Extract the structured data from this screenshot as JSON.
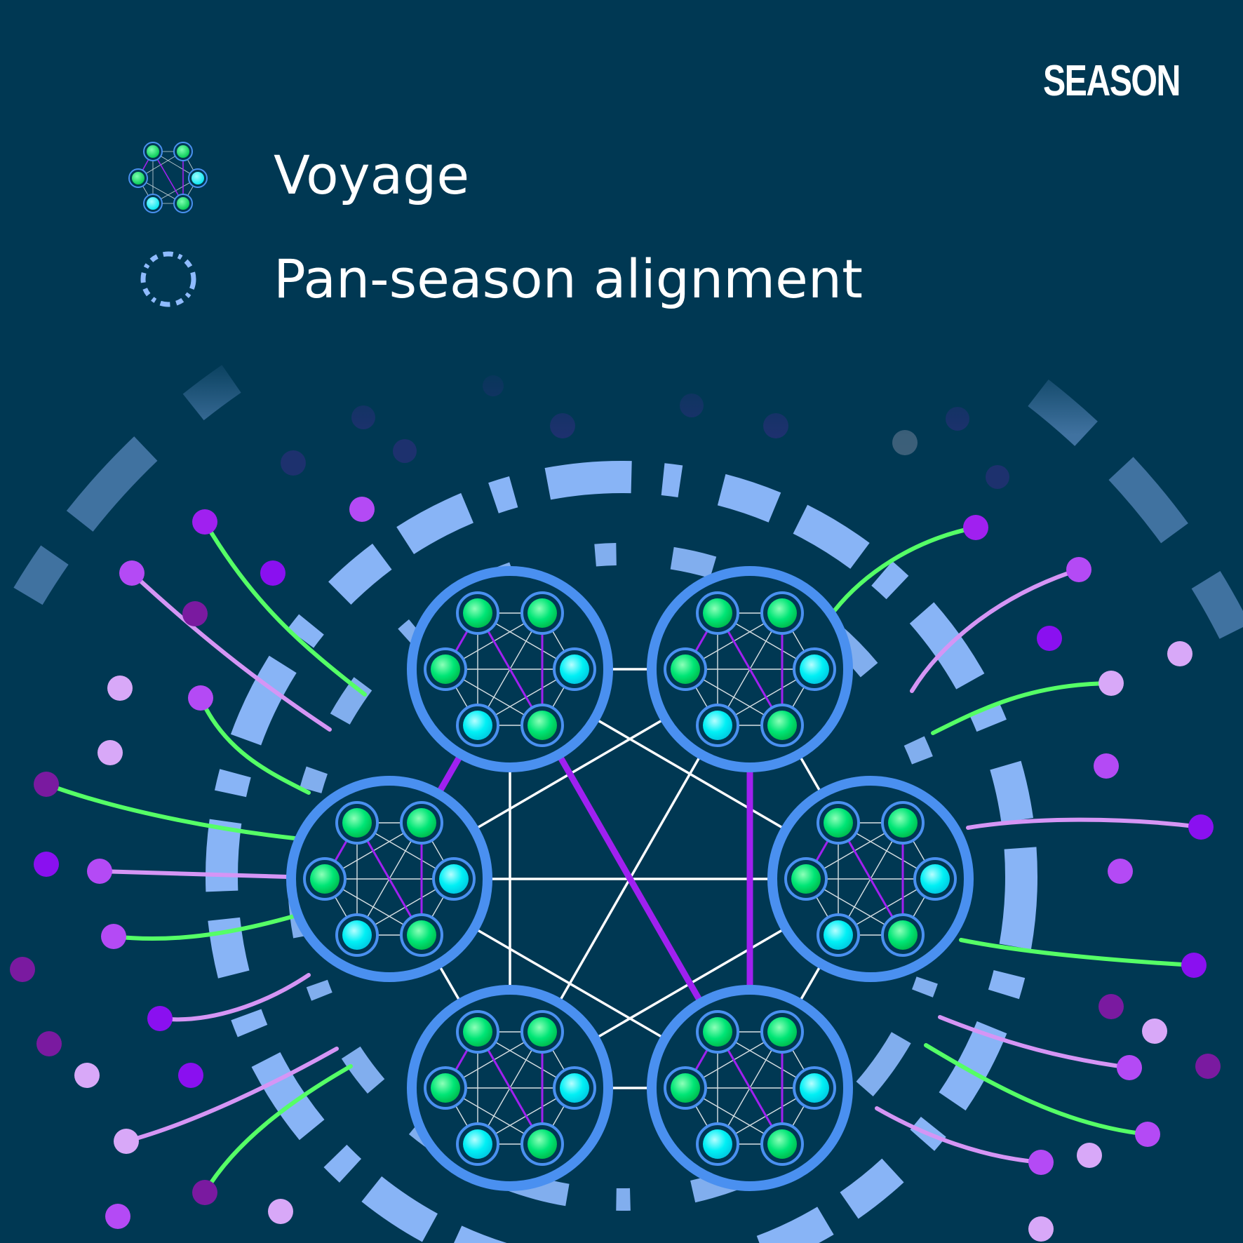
{
  "brand": {
    "text": "SEASON"
  },
  "legend": [
    {
      "label": "Voyage",
      "icon": "voyage-network-icon"
    },
    {
      "label": "Pan-season alignment",
      "icon": "dashed-ring-icon"
    }
  ],
  "colors": {
    "background": "#003853",
    "ring": "#8FBBFF",
    "cluster_border": "#4A90F0",
    "node_green": "#00E676",
    "node_cyan": "#00F0F5",
    "purple": "#A020F0",
    "green_line": "#55FF66",
    "lilac_line": "#D595F5"
  }
}
